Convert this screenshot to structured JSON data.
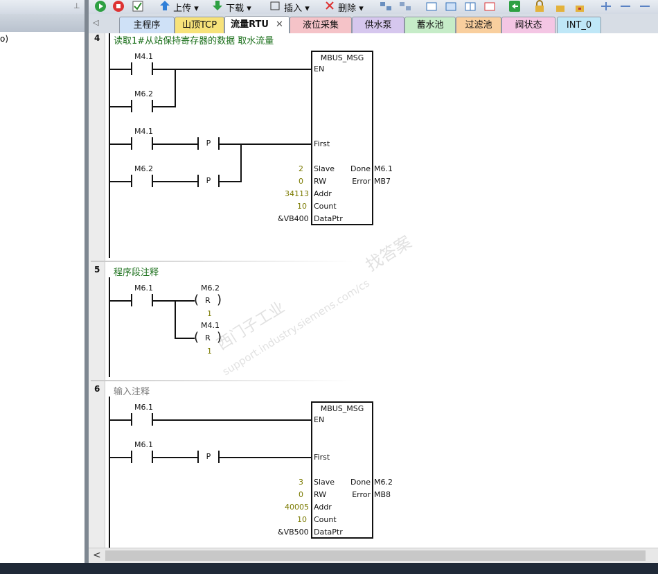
{
  "toolbar": {
    "upload_label": "上传",
    "download_label": "下载",
    "insert_label": "插入",
    "delete_label": "删除"
  },
  "left_pane": {
    "item_label": "o)"
  },
  "tabs": [
    {
      "label": "主程序",
      "color": "#cfe1f7"
    },
    {
      "label": "山顶TCP",
      "color": "#f7e27a"
    },
    {
      "label": "流量RTU",
      "color": "#e6f0b6"
    },
    {
      "label": "液位采集",
      "color": "#f5c3c8"
    },
    {
      "label": "供水泵",
      "color": "#d6c7ee"
    },
    {
      "label": "蓄水池",
      "color": "#c6ecc8"
    },
    {
      "label": "过滤池",
      "color": "#f9cf9e"
    },
    {
      "label": "阀状态",
      "color": "#f4c6e4"
    },
    {
      "label": "INT_0",
      "color": "#bfe7f7"
    }
  ],
  "tab_close_symbol": "✕",
  "networks": [
    {
      "number": "4",
      "comment": "读取1#从站保持寄存器的数据  取水流量",
      "contacts": [
        "M4.1",
        "M6.2",
        "M4.1",
        "M6.2"
      ],
      "edge_labels": [
        "P",
        "P"
      ],
      "block": {
        "title": "MBUS_MSG",
        "inputs": [
          "EN",
          "First",
          "Slave",
          "RW",
          "Addr",
          "Count",
          "DataPtr"
        ],
        "input_values": [
          "2",
          "0",
          "34113",
          "10",
          "&VB400"
        ],
        "outputs": [
          "Done",
          "Error"
        ],
        "output_values": [
          "M6.1",
          "MB7"
        ]
      }
    },
    {
      "number": "5",
      "comment": "程序段注释",
      "contacts": [
        "M6.1"
      ],
      "coils": [
        {
          "address": "M6.2",
          "op": "R",
          "count": "1"
        },
        {
          "address": "M4.1",
          "op": "R",
          "count": "1"
        }
      ]
    },
    {
      "number": "6",
      "comment": "输入注释",
      "contacts": [
        "M6.1",
        "M6.1"
      ],
      "edge_labels": [
        "P"
      ],
      "block": {
        "title": "MBUS_MSG",
        "inputs": [
          "EN",
          "First",
          "Slave",
          "RW",
          "Addr",
          "Count",
          "DataPtr"
        ],
        "input_values": [
          "3",
          "0",
          "40005",
          "10",
          "&VB500"
        ],
        "outputs": [
          "Done",
          "Error"
        ],
        "output_values": [
          "M6.2",
          "MB8"
        ]
      }
    }
  ],
  "watermark": {
    "line1": "西门子工业",
    "line2": "support.industry.siemens.com/cs",
    "line3": "找答案"
  },
  "colors": {
    "comment_green": "#1a6f1a",
    "comment_gray": "#7a7a7a",
    "value_olive": "#7b7a00"
  }
}
